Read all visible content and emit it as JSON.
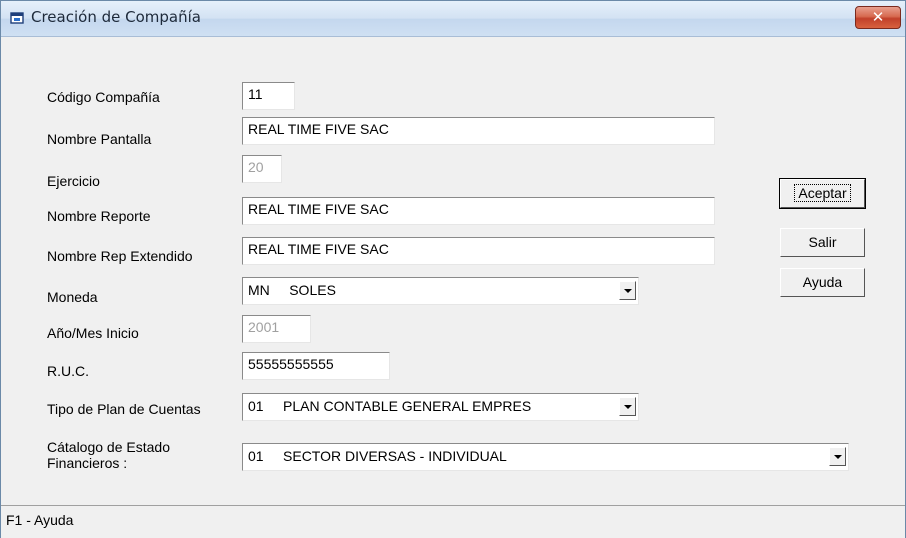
{
  "window": {
    "title": "Creación de Compañía",
    "close_label": "✕"
  },
  "form": {
    "codigo": {
      "label": "Código Compañía",
      "value": "11"
    },
    "nombre_pantalla": {
      "label": "Nombre Pantalla",
      "value": "REAL TIME FIVE SAC"
    },
    "ejercicio": {
      "label": "Ejercicio",
      "value": "20"
    },
    "nombre_reporte": {
      "label": "Nombre Reporte",
      "value": "REAL TIME FIVE SAC"
    },
    "nombre_rep_ext": {
      "label": "Nombre Rep Extendido",
      "value": "REAL TIME FIVE SAC"
    },
    "moneda": {
      "label": "Moneda",
      "value": "MN     SOLES"
    },
    "anio_mes": {
      "label": "Año/Mes Inicio",
      "value": "2001"
    },
    "ruc": {
      "label": "R.U.C.",
      "value": "55555555555"
    },
    "tipo_plan": {
      "label": "Tipo de Plan de Cuentas",
      "value": "01     PLAN CONTABLE GENERAL EMPRES"
    },
    "catalogo": {
      "label_line1": "Cátalogo de Estado",
      "label_line2": "Financieros :",
      "value": "01     SECTOR DIVERSAS - INDIVIDUAL"
    }
  },
  "buttons": {
    "aceptar": "Aceptar",
    "salir": "Salir",
    "ayuda": "Ayuda"
  },
  "status": {
    "text": "F1 - Ayuda"
  }
}
